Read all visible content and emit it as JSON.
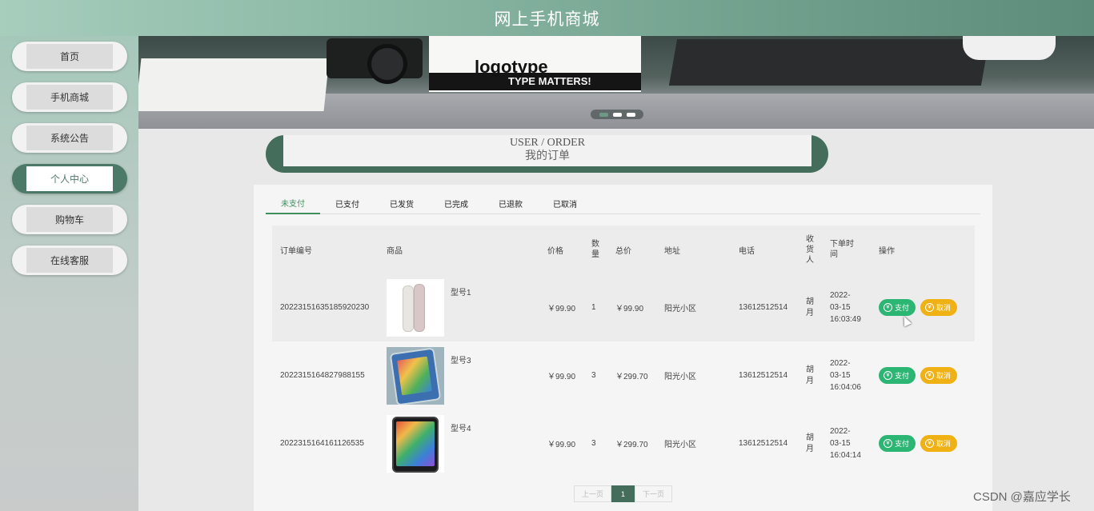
{
  "header": {
    "title": "网上手机商城"
  },
  "sidebar": {
    "items": [
      {
        "label": "首页",
        "active": false
      },
      {
        "label": "手机商城",
        "active": false
      },
      {
        "label": "系统公告",
        "active": false
      },
      {
        "label": "个人中心",
        "active": true
      },
      {
        "label": "购物车",
        "active": false
      },
      {
        "label": "在线客服",
        "active": false
      }
    ]
  },
  "banner": {
    "book_title": "logotype",
    "book_subtitle": "TYPE MATTERS!"
  },
  "page_title": {
    "en": "USER / ORDER",
    "cn": "我的订单"
  },
  "tabs": [
    "未支付",
    "已支付",
    "已发货",
    "已完成",
    "已退款",
    "已取消"
  ],
  "active_tab": "未支付",
  "table": {
    "headers": {
      "order_no": "订单编号",
      "goods": "商品",
      "price": "价格",
      "qty": "数量",
      "total": "总价",
      "address": "地址",
      "phone": "电话",
      "receiver": "收货人",
      "time": "下单时间",
      "actions": "操作"
    },
    "rows": [
      {
        "order_no": "20223151635185920230",
        "goods": "型号1",
        "price": "￥99.90",
        "qty": "1",
        "total": "￥99.90",
        "address": "阳光小区",
        "phone": "13612512514",
        "receiver": "胡月",
        "date": "2022-03-15",
        "time": "16:03:49"
      },
      {
        "order_no": "2022315164827988155",
        "goods": "型号3",
        "price": "￥99.90",
        "qty": "3",
        "total": "￥299.70",
        "address": "阳光小区",
        "phone": "13612512514",
        "receiver": "胡月",
        "date": "2022-03-15",
        "time": "16:04:06"
      },
      {
        "order_no": "2022315164161126535",
        "goods": "型号4",
        "price": "￥99.90",
        "qty": "3",
        "total": "￥299.70",
        "address": "阳光小区",
        "phone": "13612512514",
        "receiver": "胡月",
        "date": "2022-03-15",
        "time": "16:04:14"
      }
    ],
    "pay_label": "支付",
    "cancel_label": "取消"
  },
  "pager": {
    "prev": "上一页",
    "current": "1",
    "next": "下一页"
  },
  "watermark": "CSDN @嘉应学长",
  "colors": {
    "accent": "#456d5c",
    "pay": "#2bb673",
    "cancel": "#f0b114",
    "tab_active": "#3f8f5f"
  }
}
